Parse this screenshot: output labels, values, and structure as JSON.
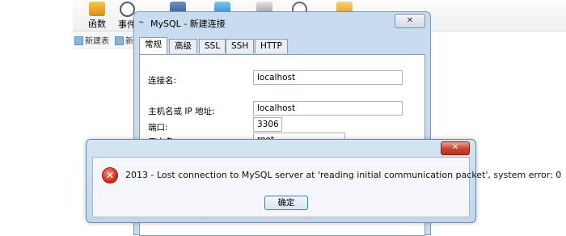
{
  "toolbar": {
    "items": [
      {
        "label": "函数",
        "icon": "function-icon"
      },
      {
        "label": "事件",
        "icon": "event-icon"
      },
      {
        "label": "",
        "icon": "user-icon"
      },
      {
        "label": "",
        "icon": "query-icon"
      },
      {
        "label": "",
        "icon": "report-icon"
      },
      {
        "label": "",
        "icon": "schedule-icon"
      },
      {
        "label": "",
        "icon": "model-icon"
      }
    ],
    "sub_items": [
      {
        "label": "新建表"
      },
      {
        "label": "新"
      }
    ]
  },
  "connection_dialog": {
    "title": "MySQL - 新建连接",
    "close_label": "✕",
    "tabs": [
      "常规",
      "高级",
      "SSL",
      "SSH",
      "HTTP"
    ],
    "fields": {
      "connection_name": {
        "label": "连接名:",
        "value": "localhost"
      },
      "host": {
        "label": "主机名或 IP 地址:",
        "value": "localhost"
      },
      "port": {
        "label": "端口:",
        "value": "3306"
      },
      "username": {
        "label": "用户名:",
        "value": "root"
      }
    }
  },
  "error_dialog": {
    "message": "2013 - Lost connection to MySQL server at 'reading initial communication packet', system error: 0",
    "ok_label": "确定",
    "close_label": "✕"
  },
  "colors": {
    "dialog_frame": "#c9dbef",
    "error_icon": "#cc2a14",
    "close_button": "#c9412d"
  }
}
